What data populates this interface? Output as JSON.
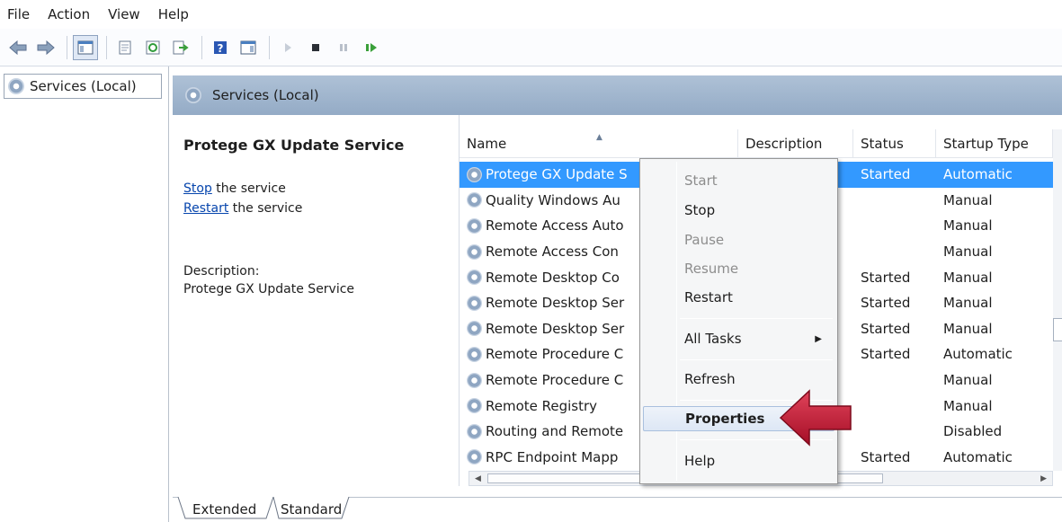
{
  "menu": [
    "File",
    "Action",
    "View",
    "Help"
  ],
  "toolbar": {
    "icons": [
      "back-arrow-icon",
      "forward-arrow-icon",
      "console-tree-icon",
      "properties-icon",
      "refresh-icon",
      "export-list-icon",
      "help-icon",
      "show-hide-action-pane-icon",
      "start-icon",
      "stop-icon",
      "pause-icon",
      "resume-icon"
    ]
  },
  "tree": {
    "root_label": "Services (Local)"
  },
  "header": {
    "title": "Services (Local)"
  },
  "details": {
    "service_title": "Protege GX Update Service",
    "stop_link": "Stop",
    "stop_suffix": " the service",
    "restart_link": "Restart",
    "restart_suffix": " the service",
    "description_label": "Description:",
    "description_text": "Protege GX Update Service"
  },
  "list": {
    "columns": [
      "Name",
      "Description",
      "Status",
      "Startup Type"
    ],
    "rows": [
      {
        "name": "Protege GX Update S",
        "description": "",
        "status": "Started",
        "startup": "Automatic",
        "selected": true
      },
      {
        "name": "Quality Windows Au",
        "description": "",
        "status": "",
        "startup": "Manual"
      },
      {
        "name": "Remote Access Auto",
        "description": "",
        "status": "",
        "startup": "Manual"
      },
      {
        "name": "Remote Access Con",
        "description": "",
        "status": "",
        "startup": "Manual"
      },
      {
        "name": "Remote Desktop Co",
        "description": "",
        "status": "Started",
        "startup": "Manual"
      },
      {
        "name": "Remote Desktop Ser",
        "description": "",
        "status": "Started",
        "startup": "Manual"
      },
      {
        "name": "Remote Desktop Ser",
        "description": "",
        "status": "Started",
        "startup": "Manual"
      },
      {
        "name": "Remote Procedure C",
        "description": "",
        "status": "Started",
        "startup": "Automatic"
      },
      {
        "name": "Remote Procedure C",
        "description": "",
        "status": "",
        "startup": "Manual"
      },
      {
        "name": "Remote Registry",
        "description": "",
        "status": "",
        "startup": "Manual"
      },
      {
        "name": "Routing and Remote",
        "description": "",
        "status": "",
        "startup": "Disabled"
      },
      {
        "name": "RPC Endpoint Mapp",
        "description": "",
        "status": "Started",
        "startup": "Automatic"
      }
    ]
  },
  "context_menu": {
    "start": "Start",
    "stop": "Stop",
    "pause": "Pause",
    "resume": "Resume",
    "restart": "Restart",
    "all_tasks": "All Tasks",
    "refresh": "Refresh",
    "properties": "Properties",
    "help": "Help"
  },
  "tabs": [
    "Extended",
    "Standard"
  ],
  "colors": {
    "selection": "#3399ff",
    "header_band": "#a4b8cf",
    "callout_arrow": "#c8102e",
    "link": "#0645ad"
  }
}
